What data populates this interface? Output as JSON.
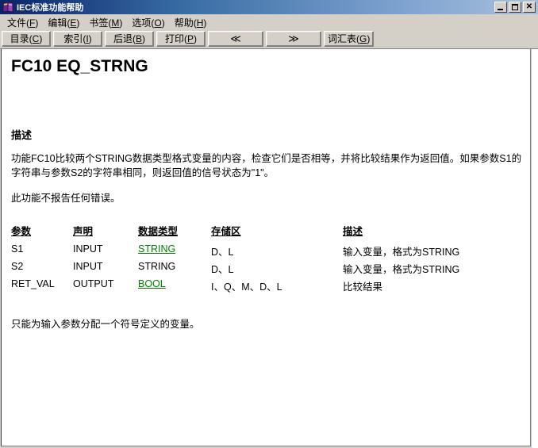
{
  "window": {
    "title": "IEC标准功能帮助",
    "icon": "book-icon",
    "minimize_label": "",
    "maximize_label": "",
    "close_label": "✕",
    "titlebar_color": "#0a246a"
  },
  "menubar": {
    "items": [
      {
        "name": "file",
        "text": "文件(F)",
        "pre": "文件(",
        "acc": "F",
        "post": ")"
      },
      {
        "name": "edit",
        "text": "编辑(E)",
        "pre": "编辑(",
        "acc": "E",
        "post": ")"
      },
      {
        "name": "bookmark",
        "text": "书签(M)",
        "pre": "书签(",
        "acc": "M",
        "post": ")"
      },
      {
        "name": "options",
        "text": "选项(O)",
        "pre": "选项(",
        "acc": "O",
        "post": ")"
      },
      {
        "name": "help",
        "text": "帮助(H)",
        "pre": "帮助(",
        "acc": "H",
        "post": ")"
      }
    ]
  },
  "toolbar": {
    "buttons": [
      {
        "name": "contents",
        "text": "目录(C)",
        "pre": "目录(",
        "acc": "C",
        "post": ")"
      },
      {
        "name": "index",
        "text": "索引(I)",
        "pre": "索引(",
        "acc": "I",
        "post": ")"
      },
      {
        "name": "back",
        "text": "后退(B)",
        "pre": "后退(",
        "acc": "B",
        "post": ")"
      },
      {
        "name": "print",
        "text": "打印(P)",
        "pre": "打印(",
        "acc": "P",
        "post": ")"
      },
      {
        "name": "prev",
        "text": "<<",
        "pre": "≪",
        "acc": "",
        "post": ""
      },
      {
        "name": "next",
        "text": ">>",
        "pre": "≫",
        "acc": "",
        "post": ""
      },
      {
        "name": "glossary",
        "text": "词汇表(G)",
        "pre": "词汇表(",
        "acc": "G",
        "post": ")"
      }
    ]
  },
  "document": {
    "title": "FC10  EQ_STRNG",
    "section_heading": "描述",
    "paragraph1": "功能FC10比较两个STRING数据类型格式变量的内容，检查它们是否相等，并将比较结果作为返回值。如果参数S1的字符串与参数S2的字符串相同，则返回值的信号状态为\"1\"。",
    "paragraph2": "此功能不报告任何错误。",
    "footnote": "只能为输入参数分配一个符号定义的变量。",
    "table": {
      "headers": [
        "参数",
        "声明",
        "数据类型",
        "存储区",
        "描述"
      ],
      "rows": [
        {
          "param": "S1",
          "declaration": "INPUT",
          "datatype": "STRING",
          "datatype_is_link": true,
          "area": "D、L",
          "description": "输入变量，格式为STRING"
        },
        {
          "param": "S2",
          "declaration": "INPUT",
          "datatype": "STRING",
          "datatype_is_link": false,
          "area": "D、L",
          "description": "输入变量，格式为STRING"
        },
        {
          "param": "RET_VAL",
          "declaration": "OUTPUT",
          "datatype": "BOOL",
          "datatype_is_link": true,
          "area": "I、Q、M、D、L",
          "description": "比较结果"
        }
      ]
    }
  },
  "colors": {
    "link_green": "#008000",
    "window_face": "#d4d0c8",
    "page_background": "#ffffff"
  }
}
